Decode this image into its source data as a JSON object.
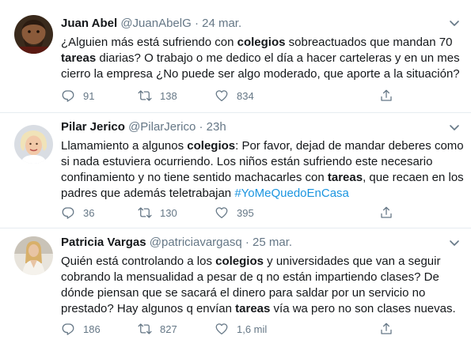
{
  "tweets": [
    {
      "name": "Juan Abel",
      "handle": "@JuanAbelG",
      "time": "24 mar.",
      "text_parts": [
        {
          "t": "¿Alguien más está sufriendo con ",
          "b": false
        },
        {
          "t": "colegios",
          "b": true
        },
        {
          "t": " sobreactuados que mandan 70 ",
          "b": false
        },
        {
          "t": "tareas",
          "b": true
        },
        {
          "t": " diarias? O trabajo o me dedico el día a hacer carteleras y en un mes cierro la empresa ¿No puede ser algo moderado, que aporte a la situación?",
          "b": false
        }
      ],
      "replies": "91",
      "retweets": "138",
      "likes": "834"
    },
    {
      "name": "Pilar Jerico",
      "handle": "@PilarJerico",
      "time": "23h",
      "text_parts": [
        {
          "t": "Llamamiento a algunos ",
          "b": false
        },
        {
          "t": "colegios",
          "b": true
        },
        {
          "t": ": Por favor, dejad de mandar deberes como si nada estuviera ocurriendo. Los niños están sufriendo este necesario confinamiento y no tiene sentido machacarles con ",
          "b": false
        },
        {
          "t": "tareas",
          "b": true
        },
        {
          "t": ", que recaen en los padres que además teletrabajan   ",
          "b": false
        },
        {
          "t": "#YoMeQuedoEnCasa",
          "b": false,
          "tag": true
        }
      ],
      "replies": "36",
      "retweets": "130",
      "likes": "395"
    },
    {
      "name": "Patricia Vargas",
      "handle": "@patriciavargasq",
      "time": "25 mar.",
      "text_parts": [
        {
          "t": "Quién está controlando a los ",
          "b": false
        },
        {
          "t": "colegios",
          "b": true
        },
        {
          "t": " y universidades que van a seguir cobrando la mensualidad a pesar de q no están impartiendo clases? De dónde piensan que se sacará el dinero para saldar por un servicio no prestado? Hay algunos q envían ",
          "b": false
        },
        {
          "t": "tareas",
          "b": true
        },
        {
          "t": " vía wa pero no son clases nuevas.",
          "b": false
        }
      ],
      "replies": "186",
      "retweets": "827",
      "likes": "1,6 mil"
    }
  ],
  "separator": "·",
  "icons": {
    "reply": "reply-icon",
    "retweet": "retweet-icon",
    "like": "heart-icon",
    "share": "share-icon",
    "more": "chevron-down-icon"
  },
  "colors": {
    "text": "#14171a",
    "muted": "#657786",
    "hashtag": "#1b95e0",
    "border": "#e6ecf0"
  }
}
